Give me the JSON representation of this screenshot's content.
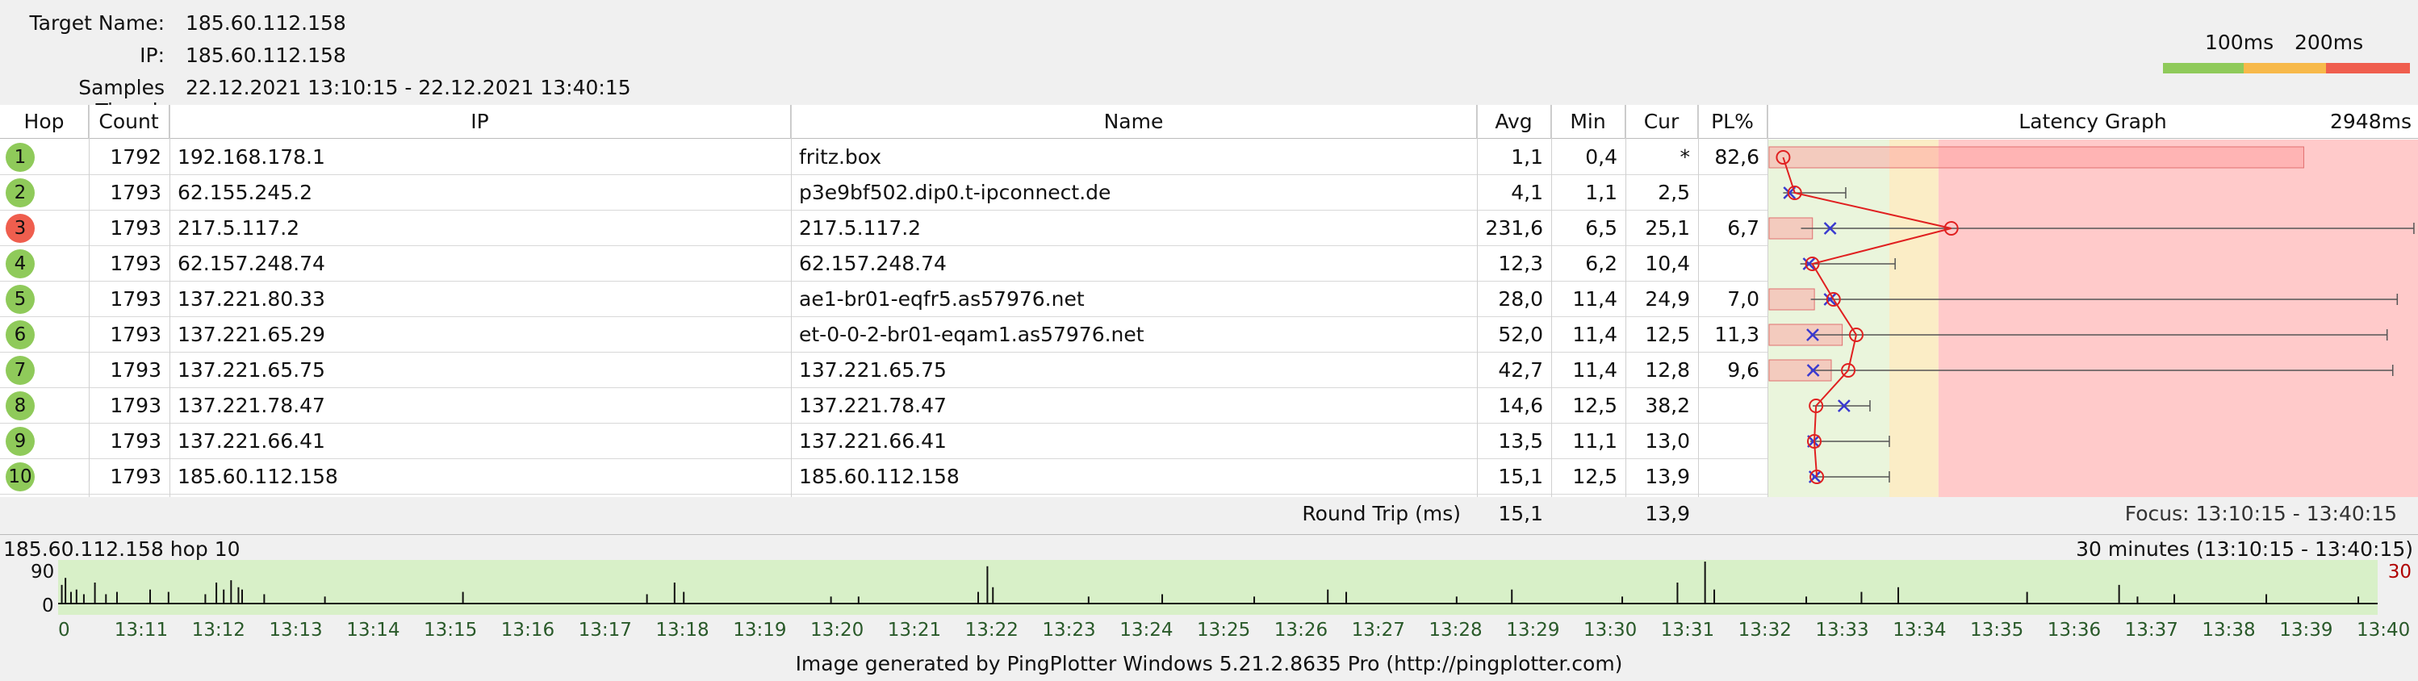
{
  "header": {
    "target_label": "Target Name:",
    "target_value": "185.60.112.158",
    "ip_label": "IP:",
    "ip_value": "185.60.112.158",
    "samples_label": "Samples Timed:",
    "samples_value": "22.12.2021 13:10:15 - 22.12.2021 13:40:15",
    "legend_100": "100ms",
    "legend_200": "200ms",
    "legend_colors": [
      "#8fca5a",
      "#f7b94a",
      "#ef5e4e"
    ]
  },
  "columns": {
    "hop": "Hop",
    "count": "Count",
    "ip": "IP",
    "name": "Name",
    "avg": "Avg",
    "min": "Min",
    "cur": "Cur",
    "pl": "PL%",
    "graph": "Latency Graph",
    "graph_max": "2948ms"
  },
  "rows": [
    {
      "hop": "1",
      "count": "1792",
      "ip": "192.168.178.1",
      "name": "fritz.box",
      "avg": "1,1",
      "min": "0,4",
      "cur": "*",
      "pl": "82,6",
      "status": "#8fca5a",
      "avg_ms": 1.1,
      "min_ms": 0.4,
      "cur_ms": null,
      "max_ms": null,
      "pl_frac": 0.826
    },
    {
      "hop": "2",
      "count": "1793",
      "ip": "62.155.245.2",
      "name": "p3e9bf502.dip0.t-ipconnect.de",
      "avg": "4,1",
      "min": "1,1",
      "cur": "2,5",
      "pl": "",
      "status": "#8fca5a",
      "avg_ms": 4.1,
      "min_ms": 1.1,
      "cur_ms": 2.5,
      "max_ms": 40,
      "pl_frac": 0
    },
    {
      "hop": "3",
      "count": "1793",
      "ip": "217.5.117.2",
      "name": "217.5.117.2",
      "avg": "231,6",
      "min": "6,5",
      "cur": "25,1",
      "pl": "6,7",
      "status": "#ef5e4e",
      "avg_ms": 231.6,
      "min_ms": 6.5,
      "cur_ms": 25.1,
      "max_ms": 2940,
      "pl_frac": 0.067
    },
    {
      "hop": "4",
      "count": "1793",
      "ip": "62.157.248.74",
      "name": "62.157.248.74",
      "avg": "12,3",
      "min": "6,2",
      "cur": "10,4",
      "pl": "",
      "status": "#8fca5a",
      "avg_ms": 12.3,
      "min_ms": 6.2,
      "cur_ms": 10.4,
      "max_ms": 110,
      "pl_frac": 0
    },
    {
      "hop": "5",
      "count": "1793",
      "ip": "137.221.80.33",
      "name": "ae1-br01-eqfr5.as57976.net",
      "avg": "28,0",
      "min": "11,4",
      "cur": "24,9",
      "pl": "7,0",
      "status": "#8fca5a",
      "avg_ms": 28.0,
      "min_ms": 11.4,
      "cur_ms": 24.9,
      "max_ms": 2790,
      "pl_frac": 0.07
    },
    {
      "hop": "6",
      "count": "1793",
      "ip": "137.221.65.29",
      "name": "et-0-0-2-br01-eqam1.as57976.net",
      "avg": "52,0",
      "min": "11,4",
      "cur": "12,5",
      "pl": "11,3",
      "status": "#8fca5a",
      "avg_ms": 52.0,
      "min_ms": 11.4,
      "cur_ms": 12.5,
      "max_ms": 2700,
      "pl_frac": 0.113
    },
    {
      "hop": "7",
      "count": "1793",
      "ip": "137.221.65.75",
      "name": "137.221.65.75",
      "avg": "42,7",
      "min": "11,4",
      "cur": "12,8",
      "pl": "9,6",
      "status": "#8fca5a",
      "avg_ms": 42.7,
      "min_ms": 11.4,
      "cur_ms": 12.8,
      "max_ms": 2750,
      "pl_frac": 0.096
    },
    {
      "hop": "8",
      "count": "1793",
      "ip": "137.221.78.47",
      "name": "137.221.78.47",
      "avg": "14,6",
      "min": "12,5",
      "cur": "38,2",
      "pl": "",
      "status": "#8fca5a",
      "avg_ms": 14.6,
      "min_ms": 12.5,
      "cur_ms": 38.2,
      "max_ms": 70,
      "pl_frac": 0
    },
    {
      "hop": "9",
      "count": "1793",
      "ip": "137.221.66.41",
      "name": "137.221.66.41",
      "avg": "13,5",
      "min": "11,1",
      "cur": "13,0",
      "pl": "",
      "status": "#8fca5a",
      "avg_ms": 13.5,
      "min_ms": 11.1,
      "cur_ms": 13.0,
      "max_ms": 100,
      "pl_frac": 0
    },
    {
      "hop": "10",
      "count": "1793",
      "ip": "185.60.112.158",
      "name": "185.60.112.158",
      "avg": "15,1",
      "min": "12,5",
      "cur": "13,9",
      "pl": "",
      "status": "#8fca5a",
      "avg_ms": 15.1,
      "min_ms": 12.5,
      "cur_ms": 13.9,
      "max_ms": 100,
      "pl_frac": 0
    }
  ],
  "graph_scale_ms": 2948,
  "summary": {
    "label": "Round Trip (ms)",
    "avg": "15,1",
    "cur": "13,9",
    "focus": "Focus: 13:10:15 - 13:40:15"
  },
  "timeline": {
    "title": "185.60.112.158 hop 10",
    "range": "30 minutes (13:10:15 - 13:40:15)",
    "y_top": "90",
    "y_bottom": "0",
    "pl_label": "30",
    "ticks": [
      "0",
      "13:11",
      "13:12",
      "13:13",
      "13:14",
      "13:15",
      "13:16",
      "13:17",
      "13:18",
      "13:19",
      "13:20",
      "13:21",
      "13:22",
      "13:23",
      "13:24",
      "13:25",
      "13:26",
      "13:27",
      "13:28",
      "13:29",
      "13:30",
      "13:31",
      "13:32",
      "13:33",
      "13:34",
      "13:35",
      "13:36",
      "13:37",
      "13:38",
      "13:39",
      "13:40"
    ],
    "spikes": [
      [
        0.002,
        40
      ],
      [
        0.004,
        55
      ],
      [
        0.007,
        25
      ],
      [
        0.01,
        30
      ],
      [
        0.014,
        20
      ],
      [
        0.02,
        45
      ],
      [
        0.026,
        20
      ],
      [
        0.032,
        25
      ],
      [
        0.05,
        30
      ],
      [
        0.06,
        25
      ],
      [
        0.08,
        20
      ],
      [
        0.086,
        45
      ],
      [
        0.09,
        30
      ],
      [
        0.094,
        50
      ],
      [
        0.098,
        35
      ],
      [
        0.1,
        30
      ],
      [
        0.112,
        20
      ],
      [
        0.145,
        15
      ],
      [
        0.22,
        25
      ],
      [
        0.32,
        20
      ],
      [
        0.335,
        45
      ],
      [
        0.34,
        25
      ],
      [
        0.42,
        15
      ],
      [
        0.435,
        15
      ],
      [
        0.5,
        25
      ],
      [
        0.505,
        80
      ],
      [
        0.508,
        35
      ],
      [
        0.56,
        15
      ],
      [
        0.6,
        20
      ],
      [
        0.65,
        15
      ],
      [
        0.69,
        30
      ],
      [
        0.7,
        25
      ],
      [
        0.76,
        15
      ],
      [
        0.79,
        30
      ],
      [
        0.85,
        15
      ],
      [
        0.88,
        45
      ],
      [
        0.895,
        90
      ],
      [
        0.9,
        30
      ],
      [
        0.95,
        15
      ],
      [
        0.98,
        25
      ],
      [
        1.0,
        35
      ],
      [
        1.07,
        25
      ],
      [
        1.12,
        40
      ],
      [
        1.13,
        15
      ],
      [
        1.15,
        20
      ],
      [
        1.2,
        20
      ],
      [
        1.25,
        15
      ]
    ]
  },
  "footer": "Image generated by PingPlotter Windows 5.21.2.8635 Pro (http://pingplotter.com)"
}
